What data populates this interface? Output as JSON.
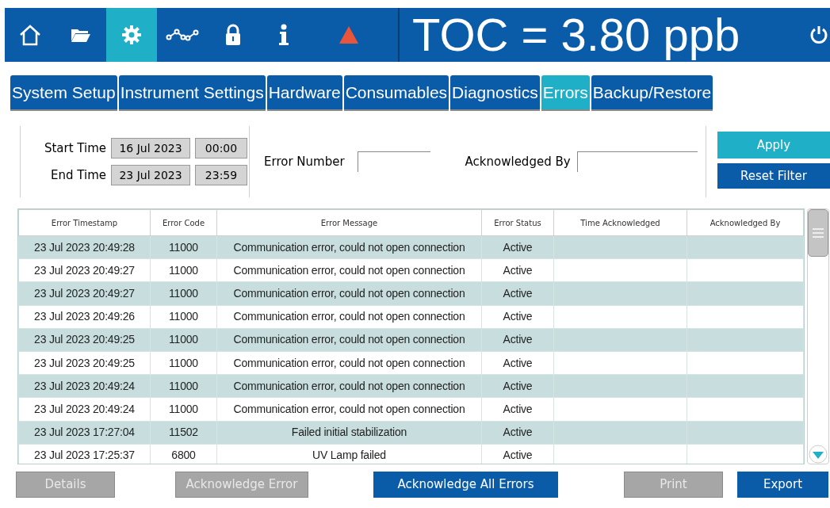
{
  "nav": [
    {
      "selected": false
    },
    {
      "selected": false
    },
    {
      "selected": true
    },
    {
      "selected": false
    },
    {
      "selected": false
    },
    {
      "selected": false
    },
    {
      "selected": false
    }
  ],
  "reading": "TOC = 3.80 ppb",
  "tabs": [
    {
      "label": "System Setup",
      "selected": false
    },
    {
      "label": "Instrument Settings",
      "selected": false
    },
    {
      "label": "Hardware",
      "selected": false
    },
    {
      "label": "Consumables",
      "selected": false
    },
    {
      "label": "Diagnostics",
      "selected": false
    },
    {
      "label": "Errors",
      "selected": true
    },
    {
      "label": "Backup/Restore",
      "selected": false
    }
  ],
  "filter": {
    "start_label": "Start Time",
    "start_date": "16 Jul 2023",
    "start_time": "00:00",
    "end_label": "End Time",
    "end_date": "23 Jul 2023",
    "end_time": "23:59",
    "error_number_label": "Error Number",
    "acknowledged_by_label": "Acknowledged By",
    "apply": "Apply",
    "reset": "Reset Filter"
  },
  "table": {
    "columns": [
      "Error Timestamp",
      "Error Code",
      "Error Message",
      "Error Status",
      "Time Acknowledged",
      "Acknowledged By"
    ],
    "rows": [
      [
        "23 Jul 2023 20:49:28",
        "11000",
        "Communication error, could not open connection",
        "Active"
      ],
      [
        "23 Jul 2023 20:49:27",
        "11000",
        "Communication error, could not open connection",
        "Active"
      ],
      [
        "23 Jul 2023 20:49:27",
        "11000",
        "Communication error, could not open connection",
        "Active"
      ],
      [
        "23 Jul 2023 20:49:26",
        "11000",
        "Communication error, could not open connection",
        "Active"
      ],
      [
        "23 Jul 2023 20:49:25",
        "11000",
        "Communication error, could not open connection",
        "Active"
      ],
      [
        "23 Jul 2023 20:49:25",
        "11000",
        "Communication error, could not open connection",
        "Active"
      ],
      [
        "23 Jul 2023 20:49:24",
        "11000",
        "Communication error, could not open connection",
        "Active"
      ],
      [
        "23 Jul 2023 20:49:24",
        "11000",
        "Communication error, could not open connection",
        "Active"
      ],
      [
        "23 Jul 2023 17:27:04",
        "11502",
        "Failed initial stabilization",
        "Active"
      ],
      [
        "23 Jul 2023 17:25:37",
        "6800",
        "UV Lamp failed",
        "Active"
      ]
    ]
  },
  "buttons": [
    {
      "label": "Details",
      "disabled": true
    },
    {
      "label": "Acknowledge Error",
      "disabled": true
    },
    {
      "label": "Acknowledge All Errors",
      "disabled": false
    },
    {
      "label": "Print",
      "disabled": true
    },
    {
      "label": "Export",
      "disabled": false
    }
  ]
}
